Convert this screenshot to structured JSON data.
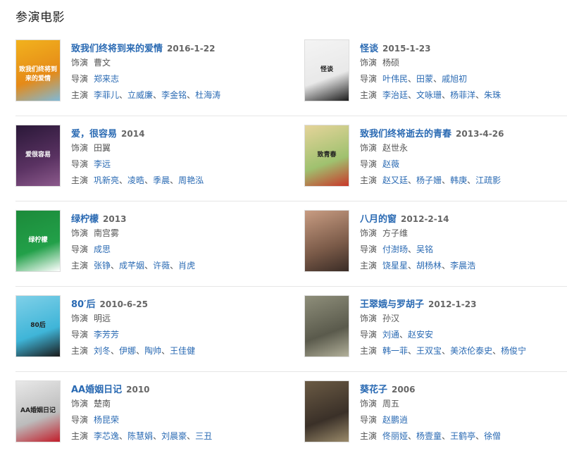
{
  "section_title": "参演电影",
  "labels": {
    "role": "饰演",
    "director": "导演",
    "cast": "主演"
  },
  "colors": {
    "link": "#2a6ab3",
    "text": "#555555",
    "divider": "#e6e6e6"
  },
  "movies": [
    {
      "title": "致我们终将到来的爱情",
      "date": "2016-1-22",
      "role": "曹文",
      "directors": [
        "郑来志"
      ],
      "cast": [
        "李菲儿",
        "立威廉",
        "李金铭",
        "杜海涛"
      ],
      "poster_text": "致我们终将到来的爱情",
      "poster_colors": [
        "#f2b21d",
        "#e58a18",
        "#7fb9d8"
      ]
    },
    {
      "title": "怪谈",
      "date": "2015-1-23",
      "role": "杨硕",
      "directors": [
        "叶伟民",
        "田蒙",
        "戚旭初"
      ],
      "cast": [
        "李治廷",
        "文咏珊",
        "杨菲洋",
        "朱珠"
      ],
      "poster_text": "怪谈",
      "poster_colors": [
        "#f4f4f4",
        "#e9e9e9",
        "#1b1b1b"
      ]
    },
    {
      "title": "爱，很容易",
      "date": "2014",
      "role": "田翼",
      "directors": [
        "李远"
      ],
      "cast": [
        "巩新亮",
        "凌晧",
        "季晨",
        "周艳泓"
      ],
      "poster_text": "爱很容易",
      "poster_colors": [
        "#2a1838",
        "#5a3262",
        "#8c5a8c"
      ]
    },
    {
      "title": "致我们终将逝去的青春",
      "date": "2013-4-26",
      "role": "赵世永",
      "directors": [
        "赵薇"
      ],
      "cast": [
        "赵又廷",
        "杨子姗",
        "韩庚",
        "江疏影"
      ],
      "poster_text": "致青春",
      "poster_colors": [
        "#e5d49a",
        "#9fc16f",
        "#c9382a"
      ]
    },
    {
      "title": "绿柠檬",
      "date": "2013",
      "role": "南宫雾",
      "directors": [
        "成思"
      ],
      "cast": [
        "张铮",
        "成芊姻",
        "许薇",
        "肖虎"
      ],
      "poster_text": "绿柠檬",
      "poster_colors": [
        "#1c8a3a",
        "#22a049",
        "#ffffff"
      ]
    },
    {
      "title": "八月的窗",
      "date": "2012-2-14",
      "role": "方子维",
      "directors": [
        "付澍旸",
        "吴铭"
      ],
      "cast": [
        "饶星星",
        "胡杨林",
        "李晨浩"
      ],
      "poster_text": "",
      "poster_colors": [
        "#c89c82",
        "#7a5a48",
        "#3a2c26"
      ]
    },
    {
      "title": "80′后",
      "date": "2010-6-25",
      "role": "明远",
      "directors": [
        "李芳芳"
      ],
      "cast": [
        "刘冬",
        "伊娜",
        "陶帅",
        "王佳健"
      ],
      "poster_text": "80后",
      "poster_colors": [
        "#7fd0e8",
        "#3fb5d8",
        "#1a1a1a"
      ]
    },
    {
      "title": "王翠娥与罗胡子",
      "date": "2012-1-23",
      "role": "孙汉",
      "directors": [
        "刘通",
        "赵安安"
      ],
      "cast": [
        "韩一菲",
        "王双宝",
        "美浓伦泰史",
        "杨俊宁"
      ],
      "poster_text": "",
      "poster_colors": [
        "#8e8e7a",
        "#5a5a4c",
        "#b2b09a"
      ]
    },
    {
      "title": "AA婚姻日记",
      "date": "2010",
      "role": "楚南",
      "directors": [
        "杨昆荣"
      ],
      "cast": [
        "李芯逸",
        "陈慧娟",
        "刘晨豪",
        "三丑"
      ],
      "poster_text": "AA婚姻日记",
      "poster_colors": [
        "#e8e8e8",
        "#bcbcbc",
        "#c21d2a"
      ]
    },
    {
      "title": "葵花子",
      "date": "2006",
      "role": "周五",
      "directors": [
        "赵鹏逍"
      ],
      "cast": [
        "佟丽娅",
        "杨壹童",
        "王鹤亭",
        "徐僧"
      ],
      "poster_text": "",
      "poster_colors": [
        "#6a5a44",
        "#3a3028",
        "#9a8a6a"
      ]
    }
  ]
}
